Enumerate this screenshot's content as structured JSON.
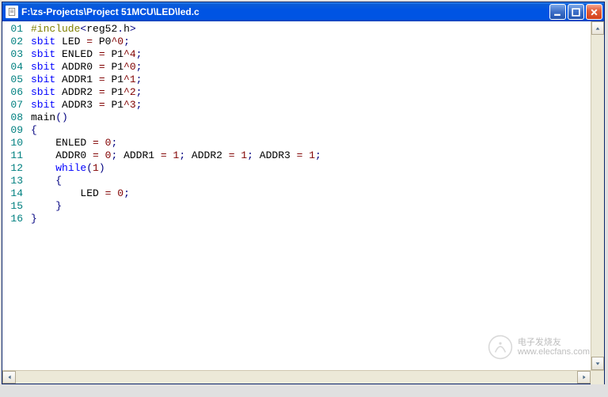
{
  "window": {
    "title": "F:\\zs-Projects\\Project 51MCU\\LED\\led.c"
  },
  "code": {
    "lines": [
      {
        "n": "01",
        "tokens": [
          [
            "pp",
            "#include"
          ],
          [
            " ",
            ""
          ],
          [
            "pun",
            "<"
          ],
          [
            " ",
            "reg52"
          ],
          [
            "pun",
            "."
          ],
          [
            " ",
            "h"
          ],
          [
            "pun",
            ">"
          ]
        ]
      },
      {
        "n": "02",
        "tokens": [
          [
            "kw",
            "sbit"
          ],
          [
            " ",
            " LED "
          ],
          [
            "op",
            "="
          ],
          [
            " ",
            " P0"
          ],
          [
            "op",
            "^"
          ],
          [
            "lit",
            "0"
          ],
          [
            "pun",
            ";"
          ]
        ]
      },
      {
        "n": "03",
        "tokens": [
          [
            "kw",
            "sbit"
          ],
          [
            " ",
            " ENLED "
          ],
          [
            "op",
            "="
          ],
          [
            " ",
            " P1"
          ],
          [
            "op",
            "^"
          ],
          [
            "lit",
            "4"
          ],
          [
            "pun",
            ";"
          ]
        ]
      },
      {
        "n": "04",
        "tokens": [
          [
            "kw",
            "sbit"
          ],
          [
            " ",
            " ADDR0 "
          ],
          [
            "op",
            "="
          ],
          [
            " ",
            " P1"
          ],
          [
            "op",
            "^"
          ],
          [
            "lit",
            "0"
          ],
          [
            "pun",
            ";"
          ]
        ]
      },
      {
        "n": "05",
        "tokens": [
          [
            "kw",
            "sbit"
          ],
          [
            " ",
            " ADDR1 "
          ],
          [
            "op",
            "="
          ],
          [
            " ",
            " P1"
          ],
          [
            "op",
            "^"
          ],
          [
            "lit",
            "1"
          ],
          [
            "pun",
            ";"
          ]
        ]
      },
      {
        "n": "06",
        "tokens": [
          [
            "kw",
            "sbit"
          ],
          [
            " ",
            " ADDR2 "
          ],
          [
            "op",
            "="
          ],
          [
            " ",
            " P1"
          ],
          [
            "op",
            "^"
          ],
          [
            "lit",
            "2"
          ],
          [
            "pun",
            ";"
          ]
        ]
      },
      {
        "n": "07",
        "tokens": [
          [
            "kw",
            "sbit"
          ],
          [
            " ",
            " ADDR3 "
          ],
          [
            "op",
            "="
          ],
          [
            " ",
            " P1"
          ],
          [
            "op",
            "^"
          ],
          [
            "lit",
            "3"
          ],
          [
            "pun",
            ";"
          ]
        ]
      },
      {
        "n": "08",
        "tokens": [
          [
            " ",
            "main"
          ],
          [
            "pun",
            "("
          ],
          [
            "pun",
            ")"
          ]
        ]
      },
      {
        "n": "09",
        "tokens": [
          [
            "pun",
            "{"
          ]
        ]
      },
      {
        "n": "10",
        "tokens": [
          [
            " ",
            "    ENLED "
          ],
          [
            "op",
            "="
          ],
          [
            " ",
            " "
          ],
          [
            "lit",
            "0"
          ],
          [
            "pun",
            ";"
          ]
        ]
      },
      {
        "n": "11",
        "tokens": [
          [
            " ",
            "    ADDR0 "
          ],
          [
            "op",
            "="
          ],
          [
            " ",
            " "
          ],
          [
            "lit",
            "0"
          ],
          [
            "pun",
            ";"
          ],
          [
            " ",
            " ADDR1 "
          ],
          [
            "op",
            "="
          ],
          [
            " ",
            " "
          ],
          [
            "lit",
            "1"
          ],
          [
            "pun",
            ";"
          ],
          [
            " ",
            " ADDR2 "
          ],
          [
            "op",
            "="
          ],
          [
            " ",
            " "
          ],
          [
            "lit",
            "1"
          ],
          [
            "pun",
            ";"
          ],
          [
            " ",
            " ADDR3 "
          ],
          [
            "op",
            "="
          ],
          [
            " ",
            " "
          ],
          [
            "lit",
            "1"
          ],
          [
            "pun",
            ";"
          ]
        ]
      },
      {
        "n": "12",
        "tokens": [
          [
            " ",
            "    "
          ],
          [
            "kw",
            "while"
          ],
          [
            "pun",
            "("
          ],
          [
            "lit",
            "1"
          ],
          [
            "pun",
            ")"
          ]
        ]
      },
      {
        "n": "13",
        "tokens": [
          [
            " ",
            "    "
          ],
          [
            "pun",
            "{"
          ]
        ]
      },
      {
        "n": "14",
        "tokens": [
          [
            " ",
            "        LED "
          ],
          [
            "op",
            "="
          ],
          [
            " ",
            " "
          ],
          [
            "lit",
            "0"
          ],
          [
            "pun",
            ";"
          ]
        ]
      },
      {
        "n": "15",
        "tokens": [
          [
            " ",
            "    "
          ],
          [
            "pun",
            "}"
          ]
        ]
      },
      {
        "n": "16",
        "tokens": [
          [
            "pun",
            "}"
          ]
        ]
      }
    ]
  },
  "watermark": {
    "line1": "电子发烧友",
    "line2": "www.elecfans.com"
  }
}
